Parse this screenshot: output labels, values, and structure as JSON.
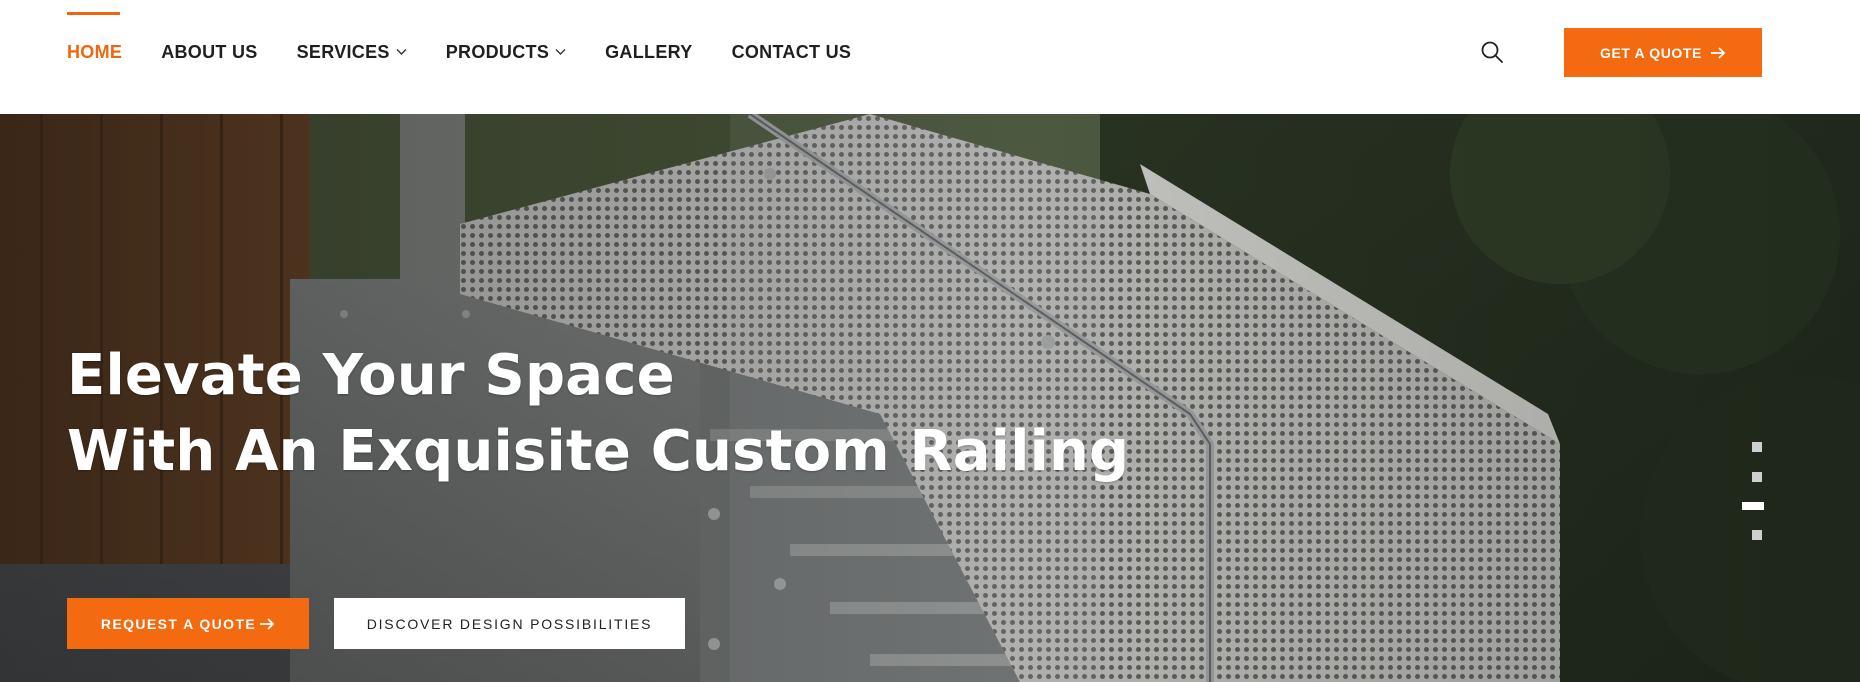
{
  "nav": {
    "items": [
      {
        "label": "HOME",
        "active": true,
        "dropdown": false
      },
      {
        "label": "ABOUT US",
        "active": false,
        "dropdown": false
      },
      {
        "label": "SERVICES",
        "active": false,
        "dropdown": true
      },
      {
        "label": "PRODUCTS",
        "active": false,
        "dropdown": true
      },
      {
        "label": "GALLERY",
        "active": false,
        "dropdown": false
      },
      {
        "label": "CONTACT US",
        "active": false,
        "dropdown": false
      }
    ],
    "search_icon": "search-icon",
    "quote_button": {
      "label": "GET A QUOTE",
      "icon": "arrow-right-icon"
    }
  },
  "hero": {
    "title_line1": "Elevate Your Space",
    "title_line2": "With An Exquisite Custom Railing",
    "primary_button": {
      "label": "REQUEST A QUOTE",
      "icon": "arrow-right-icon"
    },
    "secondary_button": {
      "label": "DISCOVER DESIGN POSSIBILITIES"
    },
    "slider": {
      "count": 4,
      "active_index": 2
    }
  },
  "colors": {
    "accent": "#f36a10",
    "nav_text": "#1f1f1f",
    "active_nav": "#f0660e"
  }
}
